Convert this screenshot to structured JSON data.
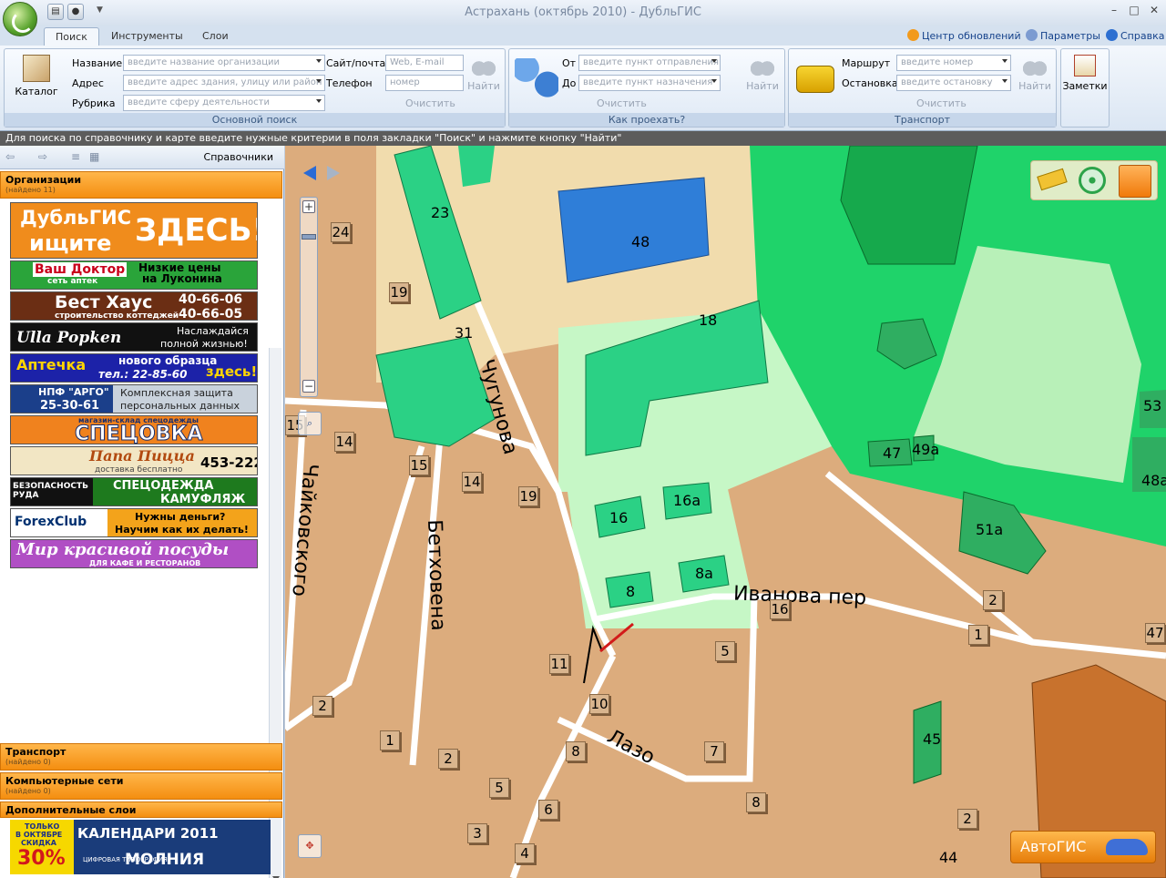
{
  "window": {
    "title": "Астрахань (октябрь 2010) - ДубльГИС"
  },
  "tabs": [
    "Поиск",
    "Инструменты",
    "Слои"
  ],
  "top_links": {
    "updates": "Центр обновлений",
    "params": "Параметры",
    "help": "Справка"
  },
  "search": {
    "catalog_label": "Каталог",
    "name_label": "Название",
    "name_placeholder": "введите название организации",
    "address_label": "Адрес",
    "address_placeholder": "введите адрес здания, улицу или район",
    "rubric_label": "Рубрика",
    "rubric_placeholder": "введите сферу деятельности",
    "site_label": "Сайт/почта",
    "site_placeholder": "Web, E-mail",
    "phone_label": "Телефон",
    "phone_placeholder": "номер",
    "clear": "Очистить",
    "find": "Найти",
    "group": "Основной поиск"
  },
  "route": {
    "from_label": "От",
    "from_placeholder": "введите пункт отправления",
    "to_label": "До",
    "to_placeholder": "введите пункт назначения",
    "clear": "Очистить",
    "find": "Найти",
    "group": "Как проехать?"
  },
  "transport": {
    "route_label": "Маршрут",
    "route_placeholder": "введите номер",
    "stop_label": "Остановка",
    "stop_placeholder": "введите остановку",
    "clear": "Очистить",
    "find": "Найти",
    "group": "Транспорт"
  },
  "notes": {
    "label": "Заметки"
  },
  "status": "Для поиска по справочнику и карте введите нужные критерии в поля закладки \"Поиск\" и нажмите кнопку \"Найти\"",
  "left": {
    "handbooks": "Справочники",
    "orgs": {
      "title": "Организации",
      "count": "(найдено 11)"
    },
    "transport": {
      "title": "Транспорт",
      "count": "(найдено 0)"
    },
    "networks": {
      "title": "Компьютерные сети",
      "count": "(найдено 0)"
    },
    "extra": {
      "title": "Дополнительные слои"
    }
  },
  "ads": [
    {
      "line1": "ДубльГИС",
      "line2": "ищите",
      "line3": "ЗДЕСЬ!"
    },
    {
      "line1": "Ваш Доктор",
      "line2": "сеть аптек",
      "line3": "Низкие цены",
      "line4": "на Луконина"
    },
    {
      "line1": "Бест Хаус",
      "line2": "строительство коттеджей",
      "line3": "40-66-06",
      "line4": "40-66-05"
    },
    {
      "line1": "Ulla Popken",
      "line2": "Наслаждайся",
      "line3": "полной жизнью!"
    },
    {
      "line1": "Аптечка",
      "line2": "нового образца",
      "line3": "тел.: 22-85-60",
      "line4": "здесь!"
    },
    {
      "line1": "НПФ \"АРГО\"",
      "line2": "25-30-61",
      "line3": "Комплексная защита",
      "line4": "персональных данных"
    },
    {
      "line1": "СПЕЦОВКА",
      "line2": "магазин-склад спецодежды"
    },
    {
      "line1": "Папа Пицца",
      "line2": "доставка бесплатно",
      "line3": "453-222"
    },
    {
      "line1": "БЕЗОПАСНОСТЬ РУДА",
      "line2": "СПЕЦОДЕЖДА",
      "line3": "КАМУФЛЯЖ"
    },
    {
      "line1": "ForexClub",
      "line2": "Нужны деньги?",
      "line3": "Научим как их делать!"
    },
    {
      "line1": "Мир красивой посуды",
      "line2": "ДЛЯ КАФЕ И РЕСТОРАНОВ"
    }
  ],
  "bottom_ad": {
    "line1": "ТОЛЬКО",
    "line2": "В ОКТЯБРЕ",
    "line3": "СКИДКА",
    "line4": "30%",
    "line5": "КАЛЕНДАРИ 2011",
    "line6": "ЦИФРОВАЯ ТИПОГРАФИЯ",
    "line7": "МОЛНИЯ"
  },
  "map": {
    "streets": [
      "Чугунова",
      "Чайковского",
      "Бетховена",
      "Иванова пер",
      "Лазо"
    ],
    "buildings": [
      "23",
      "48",
      "18",
      "31",
      "16",
      "16а",
      "8",
      "8а",
      "47",
      "49а",
      "51а",
      "48а",
      "53",
      "45",
      "44"
    ],
    "numbers": [
      "24",
      "19",
      "14",
      "15",
      "14",
      "19",
      "15",
      "16",
      "2",
      "1",
      "5",
      "11",
      "10",
      "8",
      "7",
      "2",
      "1",
      "2",
      "5",
      "6",
      "3",
      "4",
      "8",
      "2",
      "47"
    ],
    "autogis": "АвтоГИС"
  }
}
